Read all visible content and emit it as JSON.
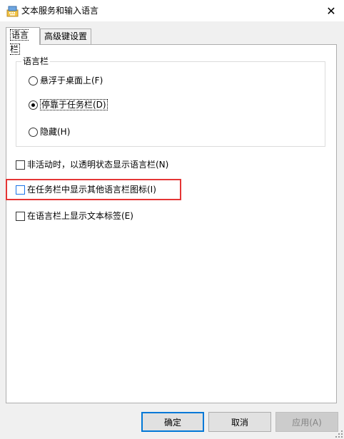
{
  "window": {
    "title": "文本服务和输入语言",
    "close_glyph": "✕"
  },
  "tabs": [
    {
      "label": "语言栏",
      "active": true
    },
    {
      "label": "高级键设置",
      "active": false
    }
  ],
  "language_bar_group": {
    "label": "语言栏",
    "options": [
      {
        "label": "悬浮于桌面上(F)",
        "selected": false
      },
      {
        "label": "停靠于任务栏(D)",
        "selected": true
      },
      {
        "label": "隐藏(H)",
        "selected": false
      }
    ]
  },
  "checkboxes": [
    {
      "label": "非活动时，以透明状态显示语言栏(N)",
      "checked": false
    },
    {
      "label": "在任务栏中显示其他语言栏图标(I)",
      "checked": false,
      "highlighted": true
    },
    {
      "label": "在语言栏上显示文本标签(E)",
      "checked": false
    }
  ],
  "buttons": {
    "ok": "确定",
    "cancel": "取消",
    "apply": "应用(A)",
    "apply_enabled": false
  },
  "colors": {
    "highlight_border": "#e53535",
    "default_button_border": "#0078d7"
  }
}
